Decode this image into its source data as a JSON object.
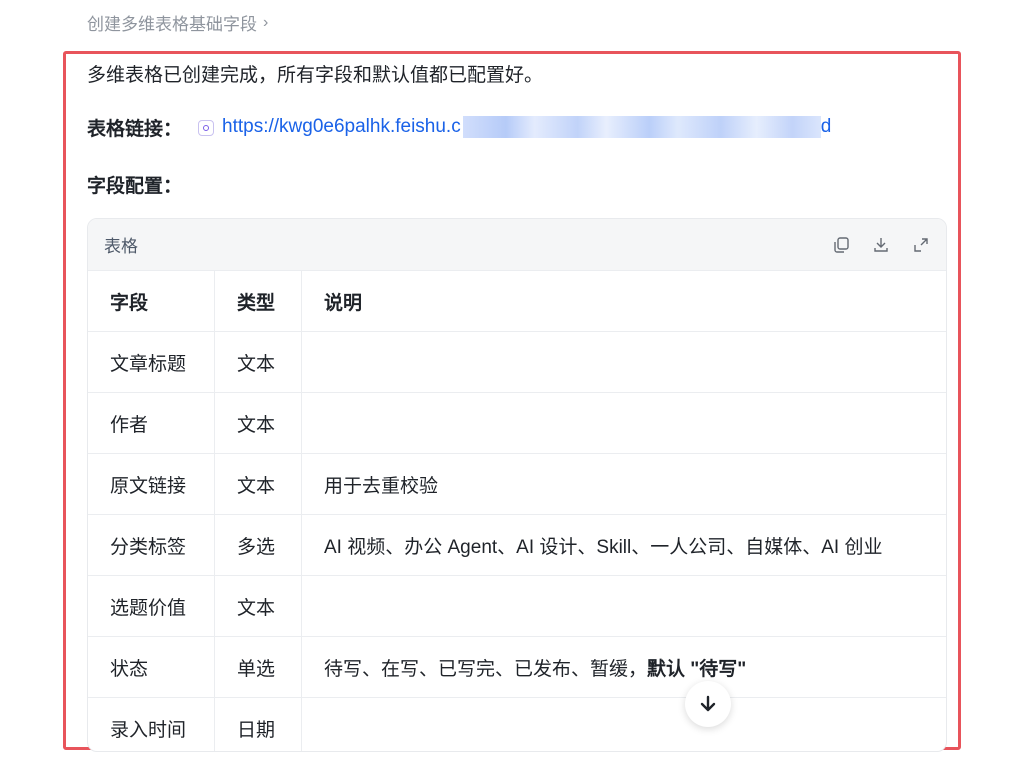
{
  "breadcrumb": {
    "label": "创建多维表格基础字段"
  },
  "message": "多维表格已创建完成，所有字段和默认值都已配置好。",
  "link": {
    "label": "表格链接：",
    "url_visible": "https://kwg0e6palhk.feishu.c",
    "url_tail": "d"
  },
  "fields_title": "字段配置：",
  "table_card": {
    "title": "表格",
    "tools": [
      "copy-icon",
      "download-icon",
      "expand-icon"
    ],
    "headers": [
      "字段",
      "类型",
      "说明"
    ],
    "rows": [
      {
        "field": "文章标题",
        "type": "文本",
        "desc": "",
        "desc_bold": ""
      },
      {
        "field": "作者",
        "type": "文本",
        "desc": "",
        "desc_bold": ""
      },
      {
        "field": "原文链接",
        "type": "文本",
        "desc": "用于去重校验",
        "desc_bold": ""
      },
      {
        "field": "分类标签",
        "type": "多选",
        "desc": "AI 视频、办公 Agent、AI 设计、Skill、一人公司、自媒体、AI 创业",
        "desc_bold": ""
      },
      {
        "field": "选题价值",
        "type": "文本",
        "desc": "",
        "desc_bold": ""
      },
      {
        "field": "状态",
        "type": "单选",
        "desc": "待写、在写、已写完、已发布、暂缓，",
        "desc_bold": "默认 \"待写\""
      },
      {
        "field": "录入时间",
        "type": "日期",
        "desc": "",
        "desc_bold": ""
      }
    ]
  },
  "colors": {
    "highlight": "#e8545b",
    "link": "#1a62e8"
  }
}
